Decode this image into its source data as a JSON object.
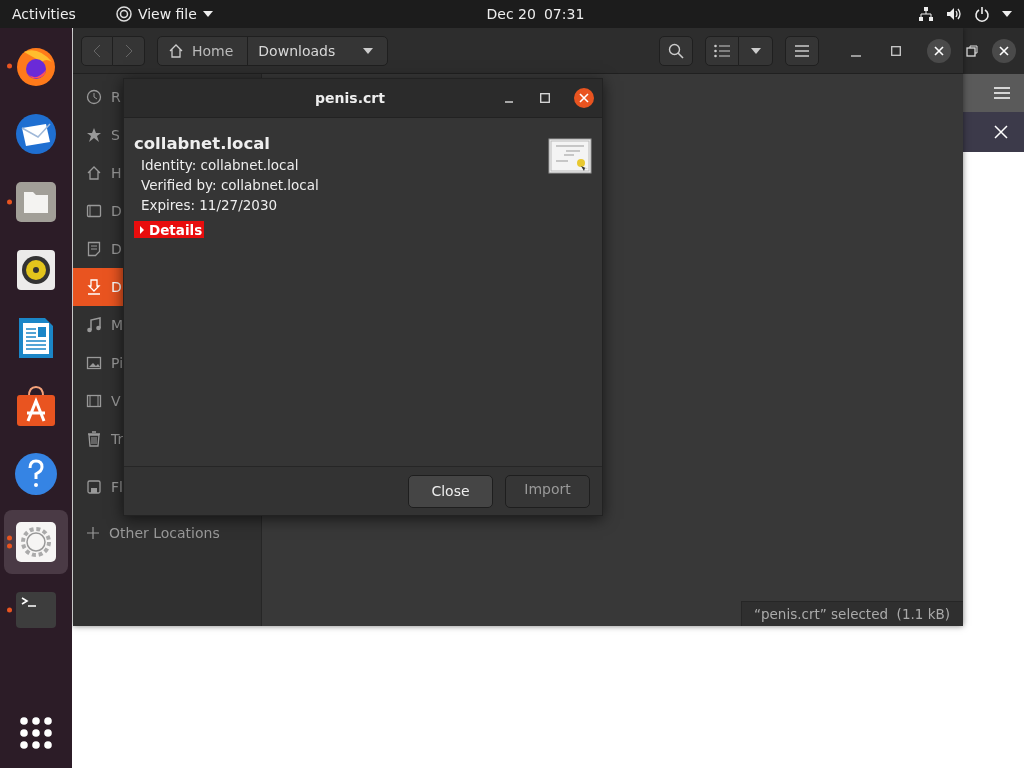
{
  "top_bar": {
    "activities": "Activities",
    "app_menu": "View file",
    "date": "Dec 20",
    "time": "07:31"
  },
  "dock": [
    {
      "kind": "firefox",
      "running": true,
      "multiple_windows": false,
      "focused": false
    },
    {
      "kind": "mail",
      "running": false,
      "multiple_windows": false,
      "focused": false
    },
    {
      "kind": "files",
      "running": true,
      "multiple_windows": false,
      "focused": false
    },
    {
      "kind": "music",
      "running": false,
      "multiple_windows": false,
      "focused": false
    },
    {
      "kind": "writer",
      "running": false,
      "multiple_windows": false,
      "focused": false
    },
    {
      "kind": "software",
      "running": false,
      "multiple_windows": false,
      "focused": false
    },
    {
      "kind": "help",
      "running": false,
      "multiple_windows": false,
      "focused": false
    },
    {
      "kind": "settings",
      "running": true,
      "multiple_windows": true,
      "focused": true
    },
    {
      "kind": "terminal",
      "running": true,
      "multiple_windows": false,
      "focused": false
    }
  ],
  "files_window": {
    "path": [
      {
        "label": "Home",
        "selected": false
      },
      {
        "label": "Downloads",
        "selected": true
      }
    ],
    "sidebar": [
      {
        "label": "R",
        "kind": "recent",
        "selected": false
      },
      {
        "label": "S",
        "kind": "starred",
        "selected": false
      },
      {
        "label": "H",
        "kind": "home",
        "selected": false
      },
      {
        "label": "D",
        "kind": "desktop",
        "selected": false
      },
      {
        "label": "D",
        "kind": "documents",
        "selected": false
      },
      {
        "label": "D",
        "kind": "downloads",
        "selected": true
      },
      {
        "label": "M",
        "kind": "music",
        "selected": false
      },
      {
        "label": "Pi",
        "kind": "pictures",
        "selected": false
      },
      {
        "label": "V",
        "kind": "videos",
        "selected": false
      },
      {
        "label": "Tr",
        "kind": "trash",
        "selected": false
      },
      {
        "label": "Fl",
        "kind": "drive",
        "selected": false
      }
    ],
    "other_locations": "Other Locations",
    "status": "“penis.crt” selected  (1.1 kB)"
  },
  "dialog": {
    "title": "penis.crt",
    "heading": "collabnet.local",
    "lines": [
      "Identity: collabnet.local",
      "Verified by: collabnet.local",
      "Expires: 11/27/2030"
    ],
    "details": {
      "label": "Details",
      "expanded": false
    },
    "buttons": [
      {
        "label": "Close",
        "disabled": false
      },
      {
        "label": "Import",
        "disabled": true
      }
    ]
  }
}
